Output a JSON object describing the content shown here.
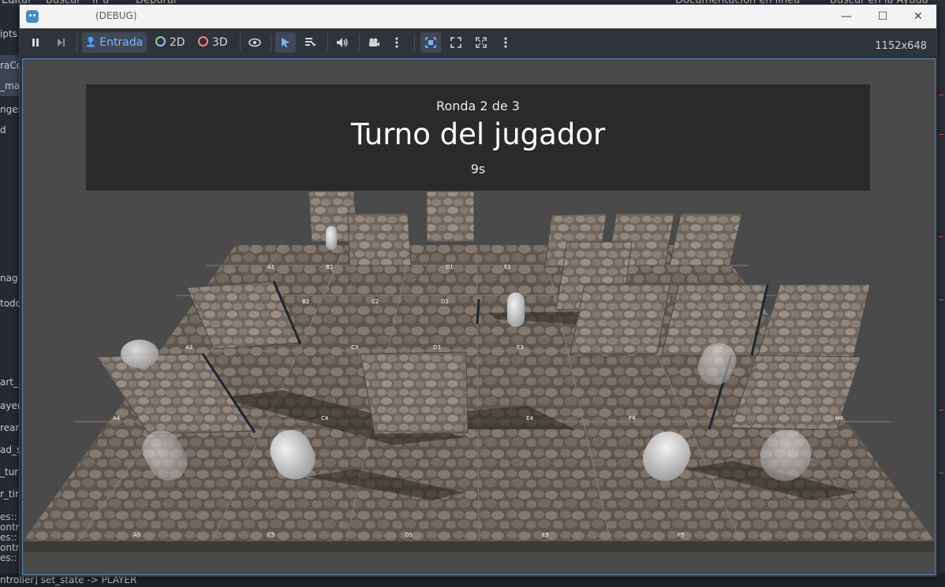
{
  "background_editor": {
    "menu": [
      "Editar",
      "Buscar",
      "Ir a",
      "Depurar"
    ],
    "menu_right": [
      "Documentación en línea",
      "Buscar en la Ayuda"
    ],
    "left_items": [
      "ipts",
      "raCo",
      "_ma",
      "ngen",
      "d",
      "nag",
      "todo",
      "art_",
      "ayer",
      "rean",
      "ad_s",
      "_tur",
      "r_tin"
    ],
    "console_lines": [
      "es::",
      "ontro",
      "es::",
      "ontro",
      "es::"
    ],
    "bottom_line": "ntroller] set_state -> PLAYER"
  },
  "window": {
    "title": "(DEBUG)",
    "controls": {
      "minimize": "—",
      "maximize": "☐",
      "close": "✕"
    }
  },
  "toolbar": {
    "pause_icon": "pause-icon",
    "next_frame_icon": "next-frame-icon",
    "input_label": "Entrada",
    "mode_2d_label": "2D",
    "mode_3d_label": "3D",
    "resolution": "1152x648",
    "accent": "#478cbf"
  },
  "hud": {
    "round": "Ronda 2 de 3",
    "title": "Turno del jugador",
    "timer": "9s"
  },
  "board": {
    "tile_labels": [
      "A5",
      "C5",
      "D5",
      "E5",
      "F5",
      "A4",
      "C4",
      "E4",
      "F4",
      "H4",
      "A3",
      "C3",
      "D3",
      "E3",
      "B2",
      "C2",
      "D2",
      "A1",
      "B1",
      "D1",
      "E1"
    ]
  }
}
